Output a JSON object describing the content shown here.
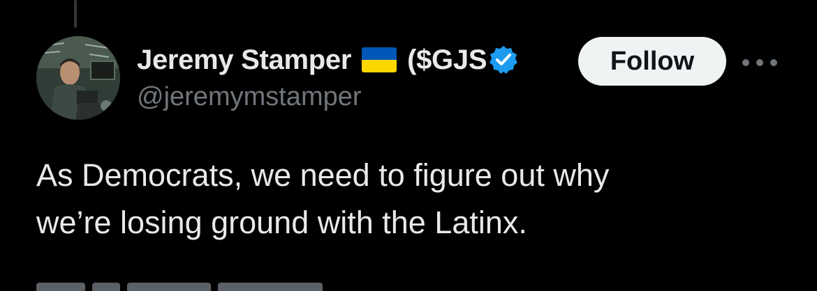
{
  "tweet": {
    "author": {
      "display_name": "Jeremy Stamper",
      "flag_icon": "ukraine-flag-icon",
      "ticker": "($GJS",
      "verified_icon": "verified-badge-icon",
      "handle": "@jeremymstamper"
    },
    "follow_label": "Follow",
    "more_icon": "more-options-icon",
    "text_lines": [
      "As Democrats, we need to figure out why",
      "we’re losing ground with the Latinx."
    ]
  },
  "colors": {
    "background": "#000000",
    "text_primary": "#e7e9ea",
    "text_secondary": "#71767b",
    "follow_bg": "#eff3f4",
    "verified_blue": "#1d9bf0",
    "flag_blue": "#0057b7",
    "flag_yellow": "#ffd700"
  }
}
